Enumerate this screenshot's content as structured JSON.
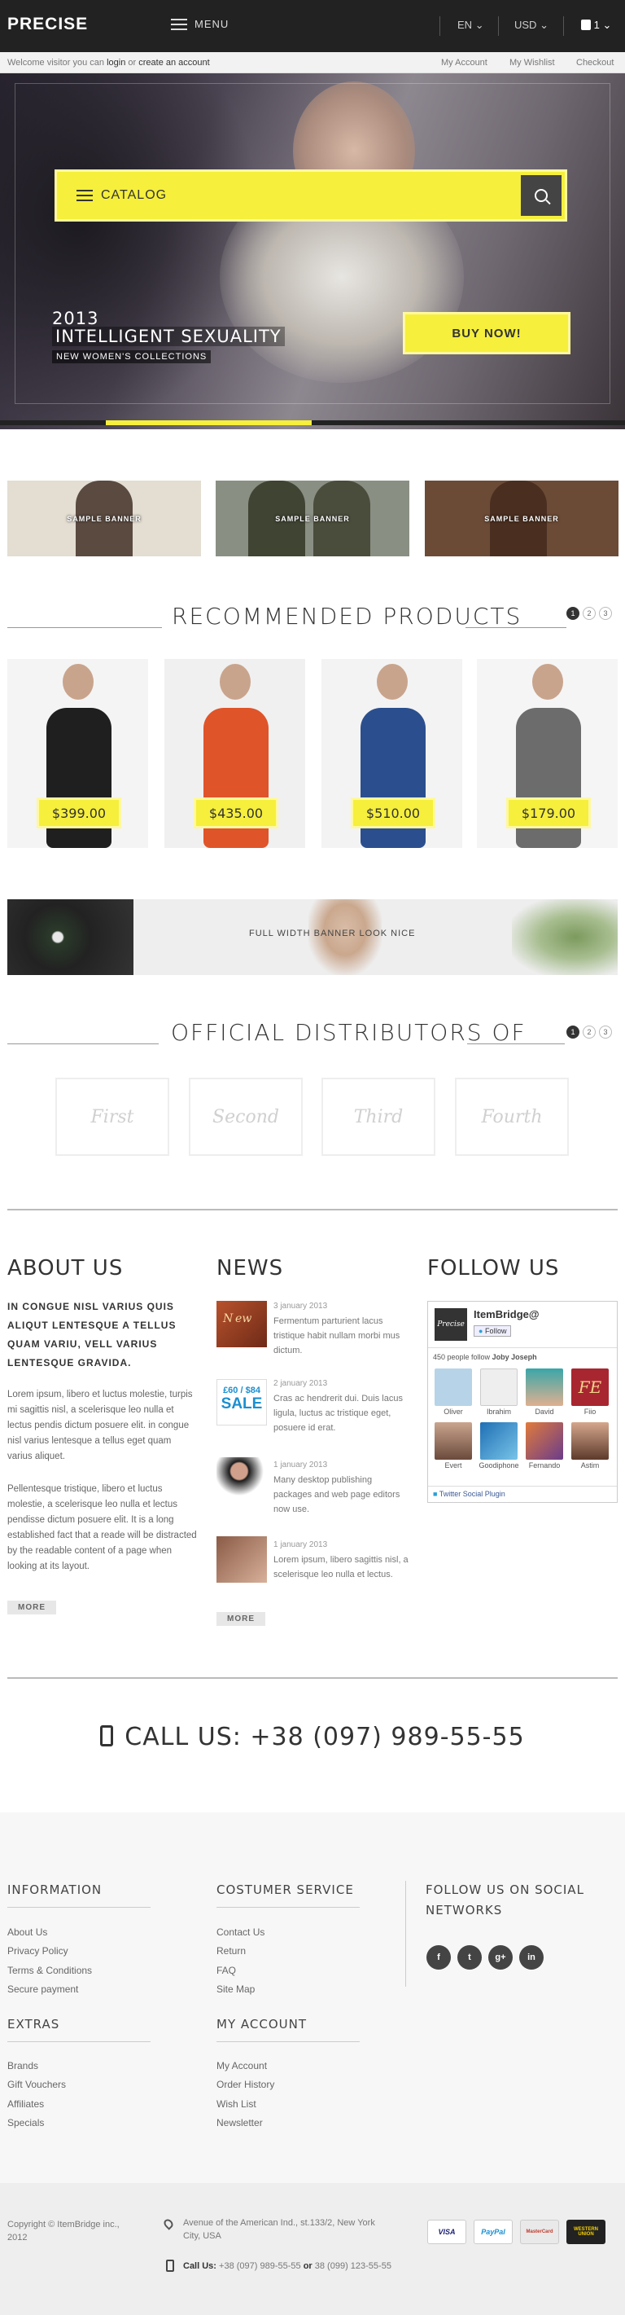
{
  "header": {
    "logo": "PRECISE",
    "menu_label": "MENU",
    "language": "EN",
    "currency": "USD",
    "cart_count": "1"
  },
  "topbar": {
    "welcome_prefix": "Welcome visitor you can",
    "login": "login",
    "or": "or",
    "create_account": "create an account",
    "links": [
      "My Account",
      "My Wishlist",
      "Checkout"
    ]
  },
  "hero": {
    "catalog_label": "CATALOG",
    "year": "2013",
    "title": "INTELLIGENT SEXUALITY",
    "subtitle": "NEW WOMEN'S COLLECTIONS",
    "buy_button": "BUY NOW!",
    "slide_progress": 0.33
  },
  "banners": [
    "SAMPLE BANNER",
    "SAMPLE BANNER",
    "SAMPLE BANNER"
  ],
  "recommended": {
    "title": "RECOMMENDED PRODUCTS",
    "pages": [
      "1",
      "2",
      "3"
    ],
    "products": [
      {
        "price": "$399.00",
        "dress_color": "#1f1f1f",
        "bg": "#f4f4f4"
      },
      {
        "price": "$435.00",
        "dress_color": "#e0542a",
        "bg": "#f0f0f0"
      },
      {
        "price": "$510.00",
        "dress_color": "#2b4f8e",
        "bg": "#f3f3f3"
      },
      {
        "price": "$179.00",
        "dress_color": "#6c6c6c",
        "bg": "#f5f5f5"
      }
    ]
  },
  "full_banner_text": "FULL WIDTH BANNER LOOK NICE",
  "distributors": {
    "title": "OFFICIAL DISTRIBUTORS OF",
    "pages": [
      "1",
      "2",
      "3"
    ],
    "items": [
      "First",
      "Second",
      "Third",
      "Fourth"
    ]
  },
  "about": {
    "title": "ABOUT US",
    "lead": "IN CONGUE NISL VARIUS QUIS ALIQUT LENTESQUE A TELLUS QUAM VARIU, VELL VARIUS LENTESQUE GRAVIDA.",
    "p1": "Lorem ipsum, libero et luctus molestie, turpis mi sagittis nisl, a scelerisque leo nulla et lectus pendis dictum posuere elit. in congue nisl varius lentesque a tellus eget quam varius aliquet.",
    "p2": "Pellentesque tristique, libero et luctus molestie, a scelerisque leo nulla et lectus pendisse dictum posuere elit. It is a long established fact that a reade will be distracted by the readable content of a page when looking at its layout.",
    "more": "MORE"
  },
  "news": {
    "title": "NEWS",
    "items": [
      {
        "date": "3 january 2013",
        "text": "Fermentum parturient lacus tristique habit nullam morbi mus dictum."
      },
      {
        "date": "2 january 2013",
        "text": "Cras ac hendrerit dui. Duis lacus ligula, luctus ac tristique eget, posuere id erat."
      },
      {
        "date": "1 january 2013",
        "text": "Many desktop publishing packages and web page editors now use."
      },
      {
        "date": "1 january 2013",
        "text": "Lorem ipsum, libero sagittis nisl, a scelerisque leo nulla et lectus."
      }
    ],
    "thumb_sale_top": "£60 / $84",
    "thumb_sale": "SALE",
    "more": "MORE"
  },
  "follow": {
    "title": "FOLLOW US",
    "page_name": "ItemBridge@",
    "follow_btn": "FoIlow",
    "logo_text": "Precise",
    "count_text": "450 people follow",
    "count_name": "Joby Joseph",
    "people": [
      "Oliver",
      "Ibrahim",
      "David",
      "Fiio",
      "Evert",
      "Goodiphone",
      "Fernando",
      "Astim"
    ],
    "plugin": "Twitter Social Plugin"
  },
  "call": "CALL US: +38 (097) 989-55-55",
  "footer": {
    "information": {
      "title": "INFORMATION",
      "links": [
        "About Us",
        "Privacy Policy",
        "Terms & Conditions",
        "Secure payment"
      ]
    },
    "service": {
      "title": "COSTUMER SERVICE",
      "links": [
        "Contact Us",
        "Return",
        "FAQ",
        "Site Map"
      ]
    },
    "extras": {
      "title": "EXTRAS",
      "links": [
        "Brands",
        "Gift Vouchers",
        "Affiliates",
        "Specials"
      ]
    },
    "account": {
      "title": "MY ACCOUNT",
      "links": [
        "My Account",
        "Order History",
        "Wish List",
        "Newsletter"
      ]
    },
    "social_title_1": "FOLLOW US ON SOCIAL",
    "social_title_2": "NETWORKS",
    "social_icons": [
      "f",
      "t",
      "g+",
      "in"
    ]
  },
  "bottom": {
    "copyright_1": "Copyright © ItemBridge inc.,",
    "copyright_2": "2012",
    "address_1": "Avenue of the American Ind., st.133/2, New York",
    "address_2": "City, USA",
    "call_label": "Call Us:",
    "phone_1": "+38 (097) 989-55-55",
    "or": "or",
    "phone_2": "38 (099) 123-55-55",
    "cards": [
      "VISA",
      "PayPal",
      "MasterCard",
      "WESTERN UNION"
    ]
  }
}
